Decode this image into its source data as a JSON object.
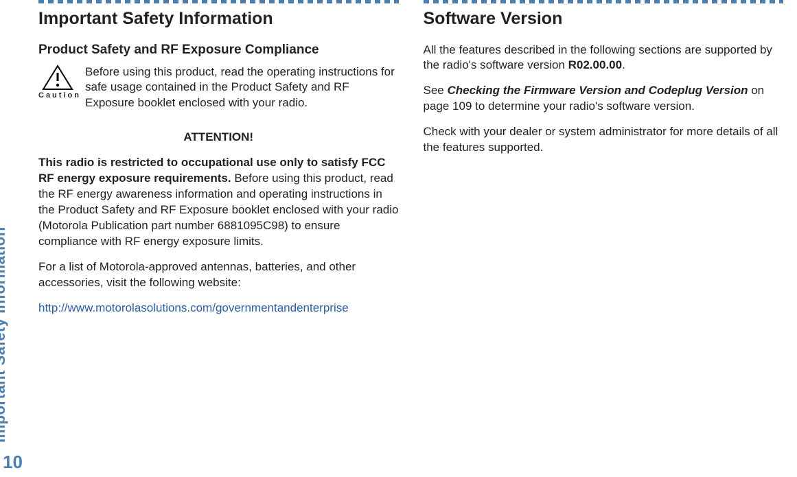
{
  "sidebar": {
    "section_title": "Important Safety Information",
    "page_number": "10"
  },
  "left": {
    "heading": "Important Safety Information",
    "subheading": "Product Safety and RF Exposure Compliance",
    "caution_label": "Caution",
    "caution_text": "Before using this product, read the operating instructions for safe usage contained in the Product Safety and RF Exposure booklet enclosed with your radio.",
    "attention": "ATTENTION!",
    "attention_bold": "This radio is restricted to occupational use only to satisfy FCC RF energy exposure requirements.",
    "attention_rest": " Before using this product, read the RF energy awareness information and operating instructions in the Product Safety and RF Exposure booklet enclosed with your radio (Motorola Publication part number 6881095C98) to ensure compliance with RF energy exposure limits.",
    "accessories_text": "For a list of Motorola-approved antennas, batteries, and other accessories, visit the following website:",
    "link": "http://www.motorolasolutions.com/governmentandenterprise"
  },
  "right": {
    "heading": "Software Version",
    "para1a": "All the features described in the following sections are supported by the radio's software version ",
    "version": "R02.00.00",
    "para1b": ".",
    "para2a": "See ",
    "ref_title": "Checking the Firmware Version and Codeplug Version",
    "para2b": " on page 109 to determine your radio's software version.",
    "para3": "Check with your dealer or system administrator for more details of all the features supported."
  }
}
